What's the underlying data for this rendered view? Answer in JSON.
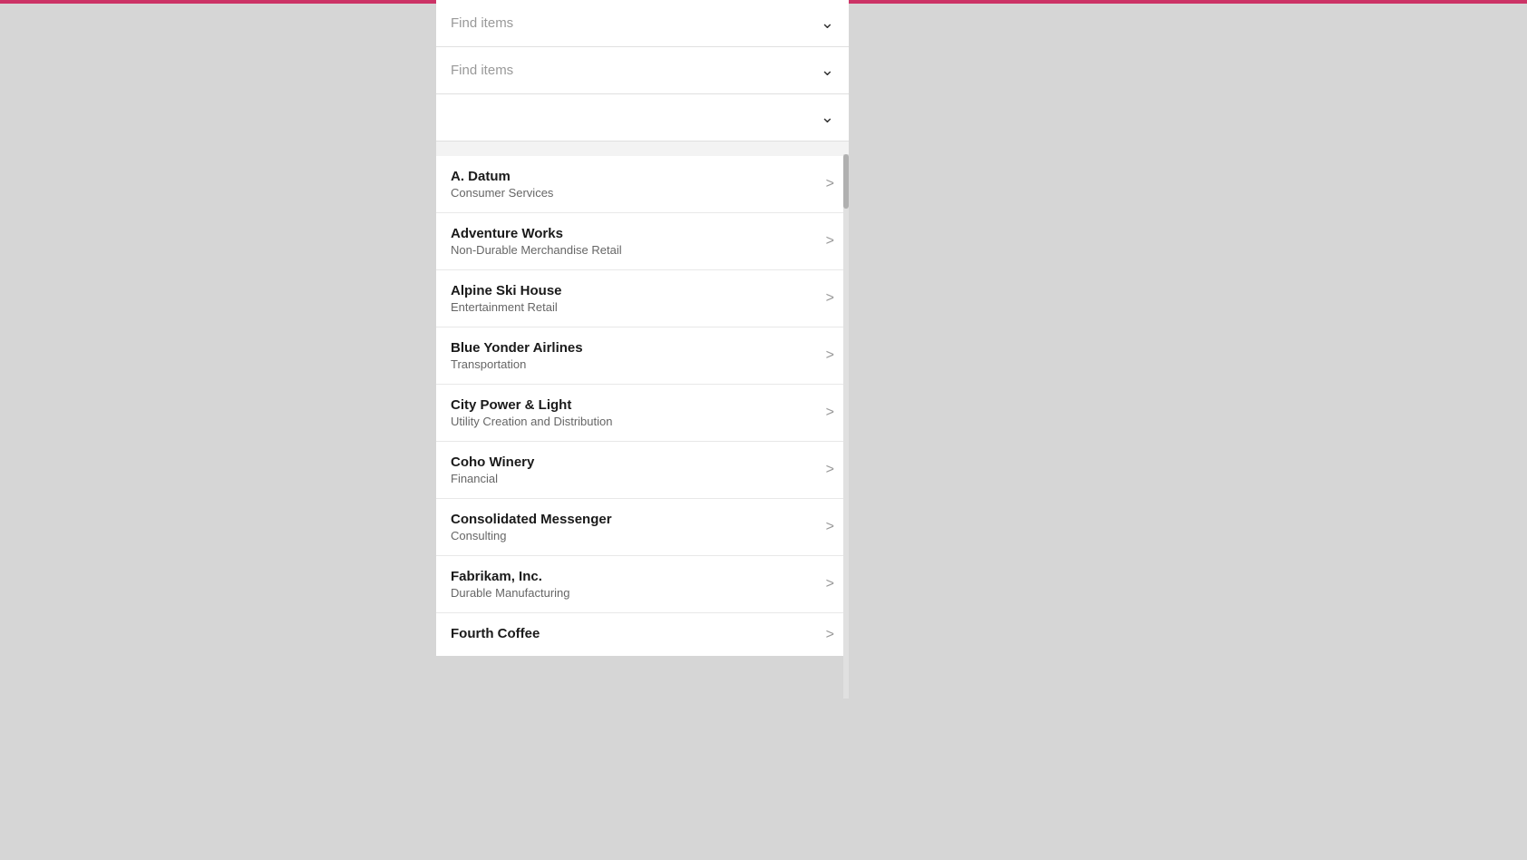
{
  "filters": [
    {
      "label": "Find items",
      "hasText": true
    },
    {
      "label": "Find items",
      "hasText": true
    },
    {
      "label": "",
      "hasText": false
    }
  ],
  "items": [
    {
      "title": "A. Datum",
      "subtitle": "Consumer Services"
    },
    {
      "title": "Adventure Works",
      "subtitle": "Non-Durable Merchandise Retail"
    },
    {
      "title": "Alpine Ski House",
      "subtitle": "Entertainment Retail"
    },
    {
      "title": "Blue Yonder Airlines",
      "subtitle": "Transportation"
    },
    {
      "title": "City Power & Light",
      "subtitle": "Utility Creation and Distribution"
    },
    {
      "title": "Coho Winery",
      "subtitle": "Financial"
    },
    {
      "title": "Consolidated Messenger",
      "subtitle": "Consulting"
    },
    {
      "title": "Fabrikam, Inc.",
      "subtitle": "Durable Manufacturing"
    },
    {
      "title": "Fourth Coffee",
      "subtitle": ""
    }
  ],
  "chevron": "›",
  "dropdown_chevron": "⌄",
  "colors": {
    "accent": "#cc3366",
    "background": "#d6d6d6",
    "panel": "#ffffff",
    "border": "#e0e0e0",
    "text_primary": "#1a1a1a",
    "text_secondary": "#666666",
    "placeholder": "#999999"
  }
}
